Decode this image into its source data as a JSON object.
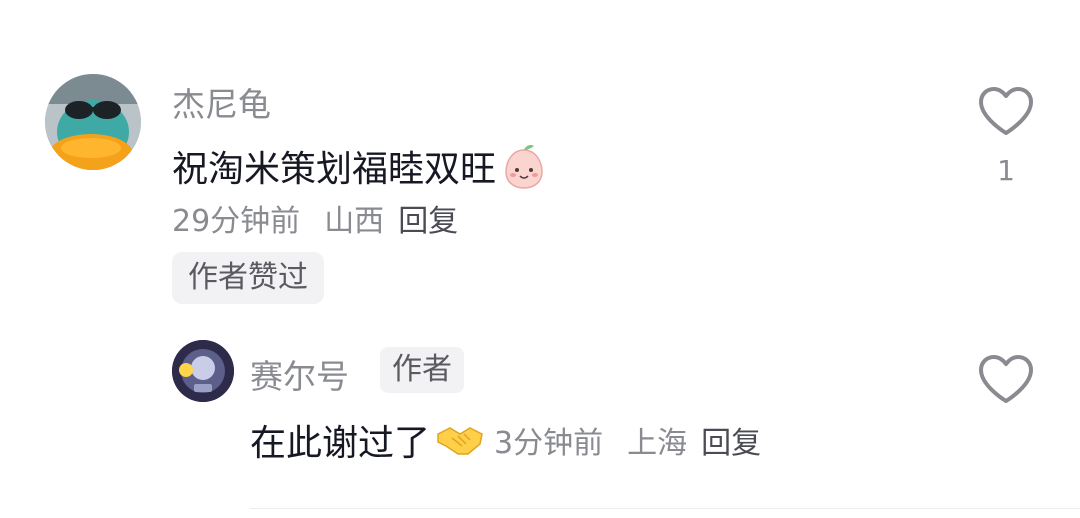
{
  "comment": {
    "username": "杰尼龟",
    "text": "祝淘米策划福睦双旺",
    "emoji": "peach-face-emoji",
    "time": "29分钟前",
    "location": "山西",
    "reply_label": "回复",
    "author_liked_chip": "作者赞过",
    "like_count": "1"
  },
  "reply": {
    "username": "赛尔号",
    "author_tag": "作者",
    "text": "在此谢过了",
    "emoji": "handshake-emoji",
    "time": "3分钟前",
    "location": "上海",
    "reply_label": "回复"
  },
  "icons": {
    "like": "heart-outline-icon"
  },
  "colors": {
    "secondary_text": "#8a8b91",
    "primary_text": "#161823",
    "chip_bg": "#f2f2f4"
  }
}
